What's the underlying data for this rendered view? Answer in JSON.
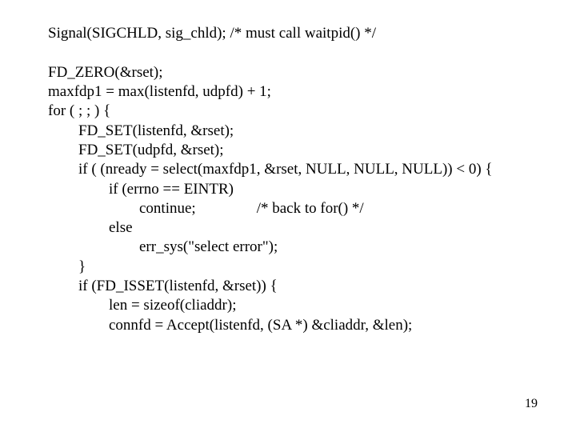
{
  "code": {
    "l01": "Signal(SIGCHLD, sig_chld); /* must call waitpid() */",
    "l02": "",
    "l03": "FD_ZERO(&rset);",
    "l04": "maxfdp1 = max(listenfd, udpfd) + 1;",
    "l05": "for ( ; ; ) {",
    "l06": "        FD_SET(listenfd, &rset);",
    "l07": "        FD_SET(udpfd, &rset);",
    "l08": "        if ( (nready = select(maxfdp1, &rset, NULL, NULL, NULL)) < 0) {",
    "l09": "                if (errno == EINTR)",
    "l10": "                        continue;                /* back to for() */",
    "l11": "                else",
    "l12": "                        err_sys(\"select error\");",
    "l13": "        }",
    "l14": "        if (FD_ISSET(listenfd, &rset)) {",
    "l15": "                len = sizeof(cliaddr);",
    "l16": "                connfd = Accept(listenfd, (SA *) &cliaddr, &len);"
  },
  "page": {
    "number": "19"
  }
}
